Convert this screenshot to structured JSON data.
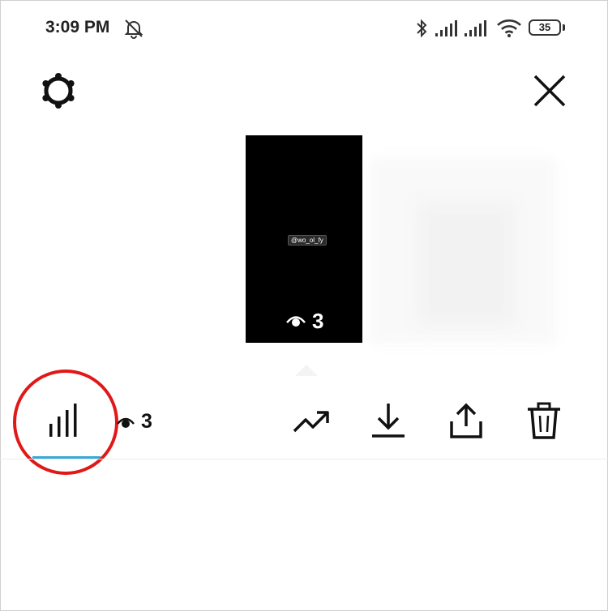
{
  "status_bar": {
    "time": "3:09 PM",
    "battery": "35",
    "icons": [
      "mute-bell-icon",
      "bluetooth-icon",
      "signal-icon",
      "signal-icon",
      "wifi-icon",
      "battery-icon"
    ]
  },
  "header": {
    "left_icon": "settings-gear-icon",
    "right_icon": "close-icon"
  },
  "story": {
    "mention": "@wo_ol_fy",
    "view_count": "3"
  },
  "toolbar": {
    "insights_icon": "bar-chart-icon",
    "view_count": "3",
    "actions": [
      "promote-trend-icon",
      "download-icon",
      "share-icon",
      "delete-trash-icon"
    ],
    "active_tab_color": "#3aa7d8",
    "highlight_color": "#e01818"
  }
}
